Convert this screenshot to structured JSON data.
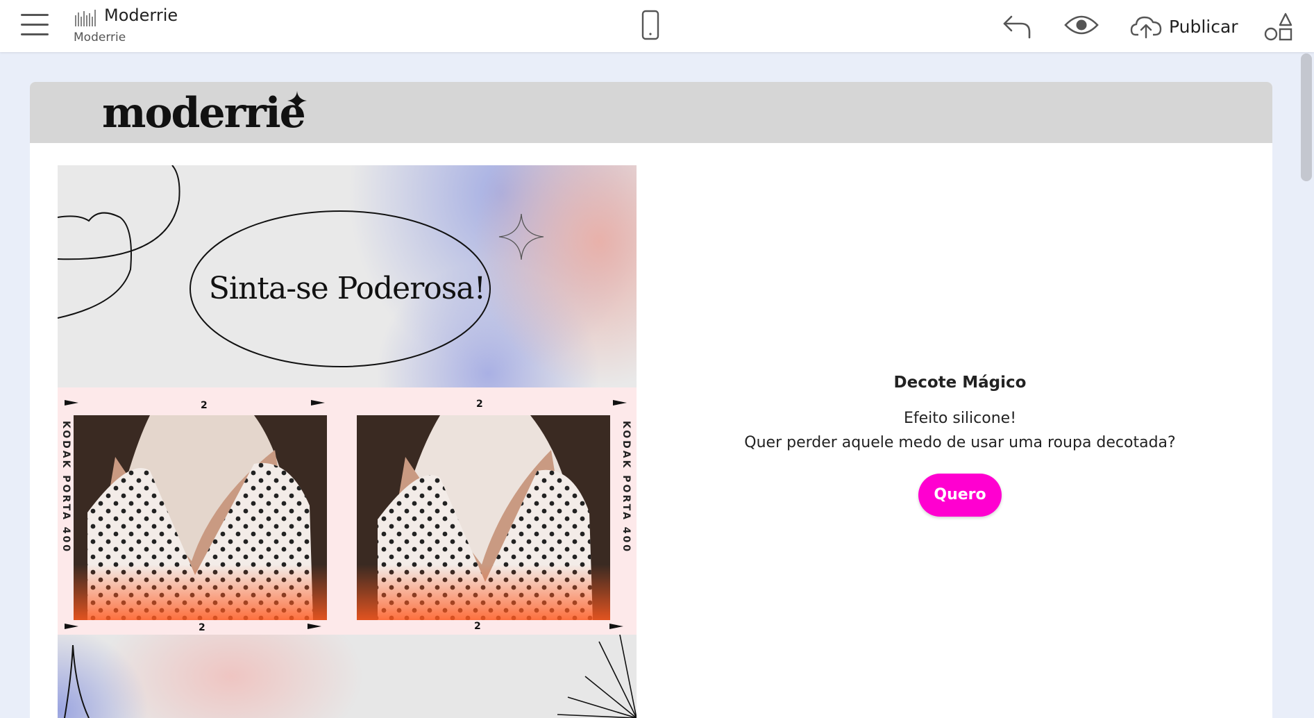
{
  "topbar": {
    "menu_icon": "hamburger-menu-icon",
    "brand_title": "Moderrie",
    "brand_subtitle": "Moderrie",
    "device_icon": "mobile-phone-icon",
    "undo_icon": "undo-arrow-icon",
    "preview_icon": "eye-icon",
    "publish_icon": "cloud-upload-icon",
    "publish_label": "Publicar",
    "shapes_icon": "shapes-icon"
  },
  "site": {
    "logo_text": "moderrie",
    "hero": {
      "title": "Sinta-se Poderosa!",
      "film_label": "KODAK PORTA 400",
      "film_number": "2"
    },
    "product": {
      "name": "Decote Mágico",
      "line1": "Efeito silicone!",
      "line2": "Quer perder aquele medo de usar uma roupa decotada?",
      "cta_label": "Quero"
    }
  },
  "colors": {
    "cta": "#ff00d0",
    "header_band": "#d6d6d6",
    "workspace_bg": "#e9eef9",
    "film_bg": "#fde9ea"
  }
}
